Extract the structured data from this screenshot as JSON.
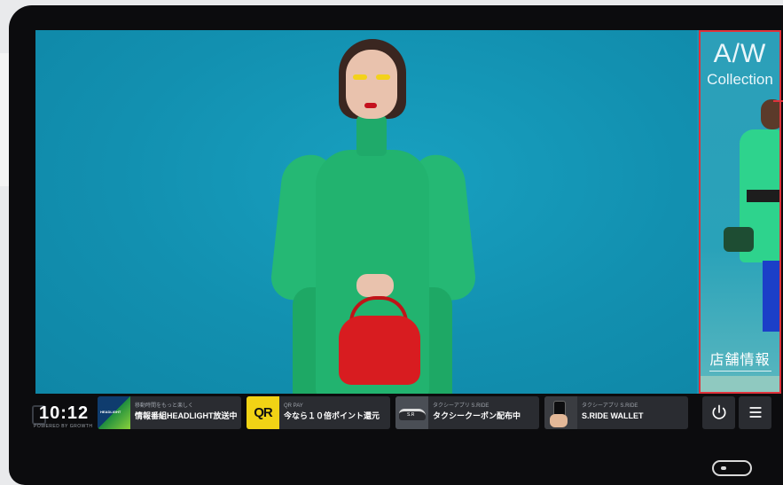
{
  "side_panel": {
    "title": "A/W",
    "subtitle": "Collection",
    "store_link": "店舗情報"
  },
  "status": {
    "time": "10:12",
    "powered_by": "POWERED BY GROWTH"
  },
  "cards": [
    {
      "thumb_label": "HEADLIGHT",
      "small": "移動時間をもっと楽しく",
      "title": "情報番組HEADLIGHT放送中"
    },
    {
      "thumb_label": "QR",
      "small": "QR PAY",
      "title": "今なら１０倍ポイント還元"
    },
    {
      "thumb_label": "",
      "small": "タクシーアプリ S.RIDE",
      "title": "タクシークーポン配布中"
    },
    {
      "thumb_label": "",
      "small": "タクシーアプリ S.RIDE",
      "title": "S.RIDE WALLET"
    }
  ],
  "colors": {
    "background": "#1595b5",
    "highlight_border": "#e0323b",
    "bar_card": "#2a2c31"
  },
  "icons": {
    "power": "power-icon",
    "menu": "menu-icon"
  }
}
